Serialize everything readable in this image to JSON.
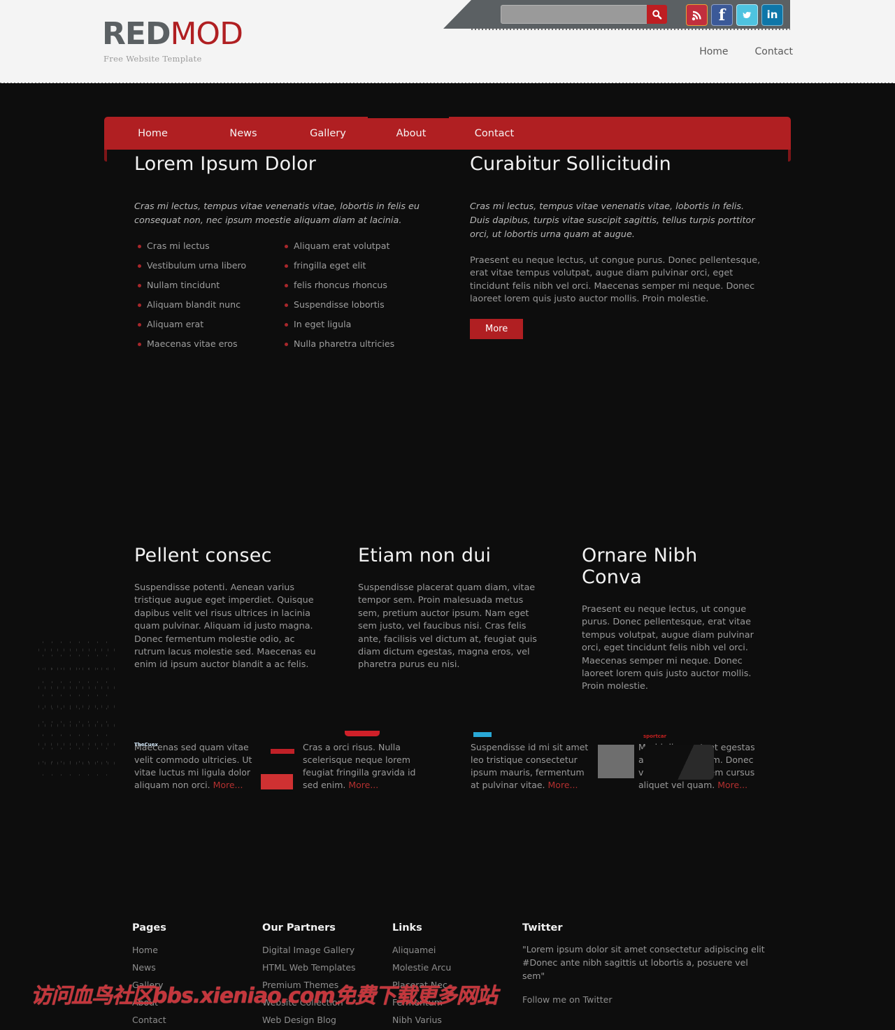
{
  "brand": {
    "name_first": "RED",
    "name_second": "MOD",
    "tagline": "Free Website Template",
    "accent_red": "#b01f22",
    "logo_gray": "#5b6063"
  },
  "search": {
    "placeholder": "",
    "value": "",
    "button_icon": "search-icon"
  },
  "social": [
    {
      "name": "rss-icon",
      "label": "RSS",
      "glyph": "◔",
      "color": "#c12f3d"
    },
    {
      "name": "facebook-icon",
      "label": "Facebook",
      "glyph": "f",
      "color": "#3b5998"
    },
    {
      "name": "twitter-icon",
      "label": "Twitter",
      "glyph": "t",
      "color": "#4ec3e0"
    },
    {
      "name": "linkedin-icon",
      "label": "LinkedIn",
      "glyph": "in",
      "color": "#0e76a8"
    }
  ],
  "top_nav": [
    {
      "label": "Home"
    },
    {
      "label": "Contact"
    }
  ],
  "main_nav": {
    "active": "About",
    "items": [
      {
        "label": "Home"
      },
      {
        "label": "News"
      },
      {
        "label": "Gallery"
      },
      {
        "label": "About"
      },
      {
        "label": "Contact"
      }
    ]
  },
  "left_column": {
    "title": "Lorem Ipsum Dolor",
    "intro": "Cras mi lectus, tempus vitae venenatis vitae, lobortis in felis eu consequat non, nec ipsum moestie aliquam diam at lacinia.",
    "list_a": [
      "Cras mi lectus",
      "Vestibulum urna libero",
      "Nullam tincidunt",
      "Aliquam blandit nunc",
      "Aliquam erat",
      "Maecenas vitae eros"
    ],
    "list_b": [
      "Aliquam erat volutpat",
      "fringilla eget elit",
      "felis rhoncus rhoncus",
      "Suspendisse lobortis",
      "In eget ligula",
      "Nulla pharetra ultricies"
    ]
  },
  "right_column": {
    "title": "Curabitur Sollicitudin",
    "intro": "Cras mi lectus, tempus vitae venenatis vitae, lobortis in felis. Duis dapibus, turpis vitae suscipit sagittis, tellus turpis porttitor orci, ut lobortis urna quam at augue.",
    "body": "Praesent eu neque lectus, ut congue purus. Donec pellentesque, erat vitae tempus volutpat, augue diam pulvinar orci, eget tincidunt felis nibh vel orci. Maecenas semper mi neque. Donec laoreet lorem quis justo auctor mollis. Proin molestie.",
    "more_label": "More"
  },
  "three_columns": [
    {
      "title": "Pellent consec",
      "body": "Suspendisse potenti. Aenean varius tristique augue eget imperdiet. Quisque dapibus velit vel risus ultrices in lacinia quam pulvinar. Aliquam id justo magna. Donec fermentum molestie odio, ac rutrum lacus molestie sed. Maecenas eu enim id ipsum auctor blandit a ac felis."
    },
    {
      "title": "Etiam non dui",
      "body": "Suspendisse placerat quam diam, vitae tempor sem. Proin malesuada metus sem, pretium auctor ipsum. Nam eget sem justo, vel faucibus nisi. Cras felis ante, facilisis vel dictum at, feugiat quis diam dictum egestas, magna eros, vel pharetra purus eu nisi."
    },
    {
      "title": "Ornare Nibh Conva",
      "body": "Praesent eu neque lectus, ut congue purus. Donec pellentesque, erat vitae tempus volutpat, augue diam pulvinar orci, eget tincidunt felis nibh vel orci. Maecenas semper mi neque. Donec laoreet lorem quis justo auctor mollis. Proin molestie."
    }
  ],
  "thumbnails": [
    {
      "caption": "Maecenas sed quam vitae velit commodo ultricies. Ut vitae luctus mi ligula dolor aliquam non orci.",
      "more": "More...",
      "art": "blue-city-website-thumbnail"
    },
    {
      "caption": "Cras a orci risus. Nulla scelerisque neque lorem feugiat fringilla gravida id sed enim.",
      "more": "More...",
      "art": "teal-food-website-thumbnail"
    },
    {
      "caption": "Suspendisse id mi sit amet leo tristique consectetur ipsum mauris, fermentum at pulvinar vitae.",
      "more": "More...",
      "art": "colorful-balloons-website-thumbnail"
    },
    {
      "caption": "Morbi diam est, et egestas a, aliquet ac quam. Donec vitae augue ut sem cursus aliquet vel quam.",
      "more": "More...",
      "art": "dark-car-website-thumbnail"
    }
  ],
  "footer": {
    "pages": {
      "title": "Pages",
      "items": [
        "Home",
        "News",
        "Gallery",
        "About",
        "Contact"
      ]
    },
    "partners": {
      "title": "Our Partners",
      "items": [
        "Digital Image Gallery",
        "HTML Web Templates",
        "Premium Themes",
        "Website Collection",
        "Web Design Blog"
      ]
    },
    "links": {
      "title": "Links",
      "items": [
        "Aliquamei",
        "Molestie Arcu",
        "Placerat Nec",
        "Fermentum",
        "Nibh Varius"
      ]
    },
    "twitter": {
      "title": "Twitter",
      "tweet": "\"Lorem ipsum dolor sit amet consectetur adipiscing elit #Donec ante nibh sagittis ut lobortis a, posuere vel sem\"",
      "follow_label": "Follow me on Twitter"
    }
  },
  "watermark": {
    "text": "访问血鸟社区bbs.xieniao.com免费下载更多网站"
  }
}
